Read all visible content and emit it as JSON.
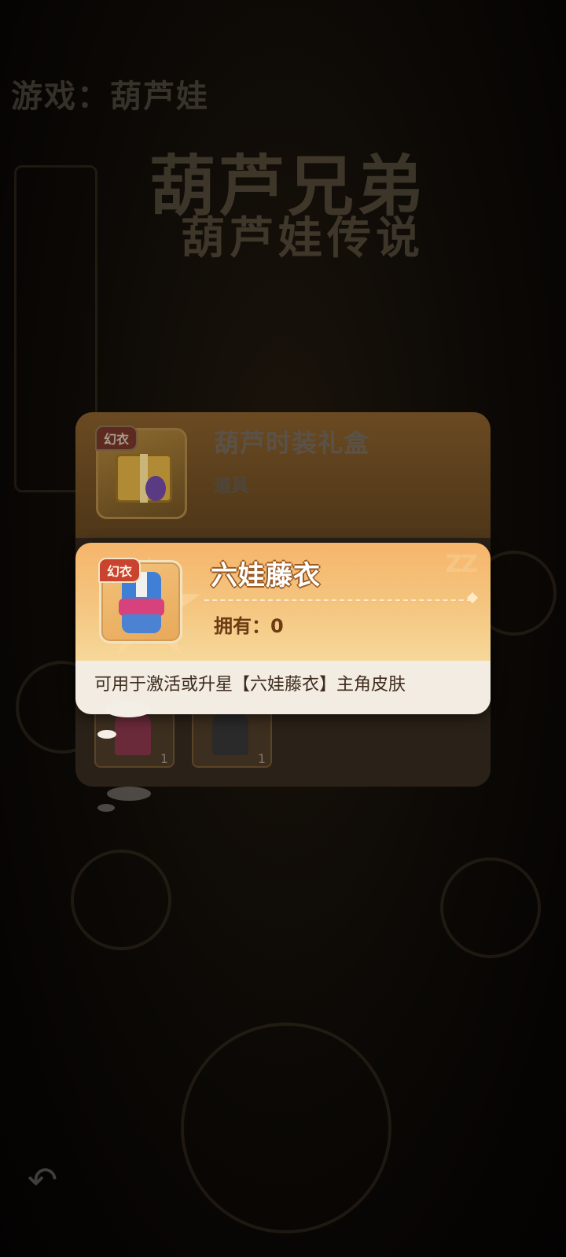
{
  "background": {
    "header_title": "游戏：葫芦娃",
    "logo_line1": "葫芦兄弟",
    "logo_line2": "葫芦娃传说"
  },
  "under_panel": {
    "item_badge": "幻衣",
    "item_name": "葫芦时装礼盒",
    "item_type": "道具",
    "slots": [
      {
        "qty": "1"
      },
      {
        "qty": "1"
      }
    ]
  },
  "tooltip": {
    "badge": "幻衣",
    "name": "六娃藤衣",
    "owned_label": "拥有：",
    "owned_value": "0",
    "description": "可用于激活或升星【六娃藤衣】主角皮肤"
  },
  "icons": {
    "back": "back-arrow-icon"
  },
  "colors": {
    "card_gradient_top": "#f6b56b",
    "card_gradient_bottom": "#f6d89a",
    "badge_red": "#c9432f",
    "description_bg": "#f2ece2"
  }
}
